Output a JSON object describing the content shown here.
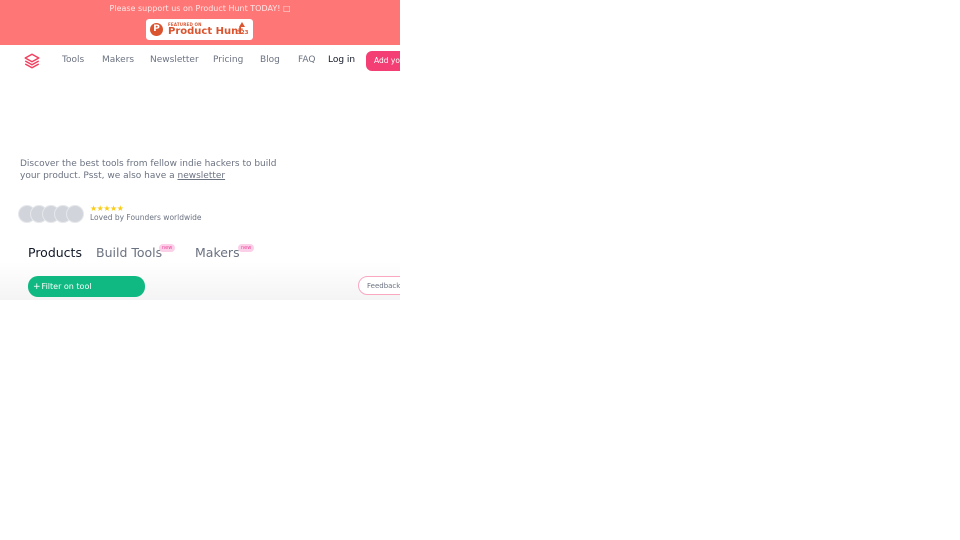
{
  "banner": {
    "text": "Please support us on Product Hunt TODAY! □",
    "badge": {
      "logo_letter": "P",
      "featured_label": "FEATURED ON",
      "name": "Product Hunt",
      "upvotes": "323"
    }
  },
  "nav": {
    "logo_icon": "stack-layers-icon",
    "links": [
      "Tools",
      "Makers",
      "Newsletter",
      "Pricing",
      "Blog",
      "FAQ"
    ],
    "login": "Log in",
    "add_button": "Add your"
  },
  "hero": {
    "description_prefix": "Discover the best tools from fellow indie hackers to build your product. Psst, we also have a ",
    "newsletter_link": "newsletter",
    "stars": "★★★★★",
    "rating": 5,
    "loved_text": "Loved by Founders worldwide",
    "avatar_count": 5
  },
  "tabs": [
    {
      "label": "Products",
      "active": true,
      "badge": null
    },
    {
      "label": "Build Tools",
      "active": false,
      "badge": "new"
    },
    {
      "label": "Makers",
      "active": false,
      "badge": "new"
    }
  ],
  "actions": {
    "filter_label": "Filter on tool",
    "filter_icon": "+",
    "feedback_label": "Feedback"
  },
  "colors": {
    "banner": "#ff7676",
    "accent_pink": "#f43f74",
    "filter_green": "#10b981",
    "star_yellow": "#facc15"
  }
}
